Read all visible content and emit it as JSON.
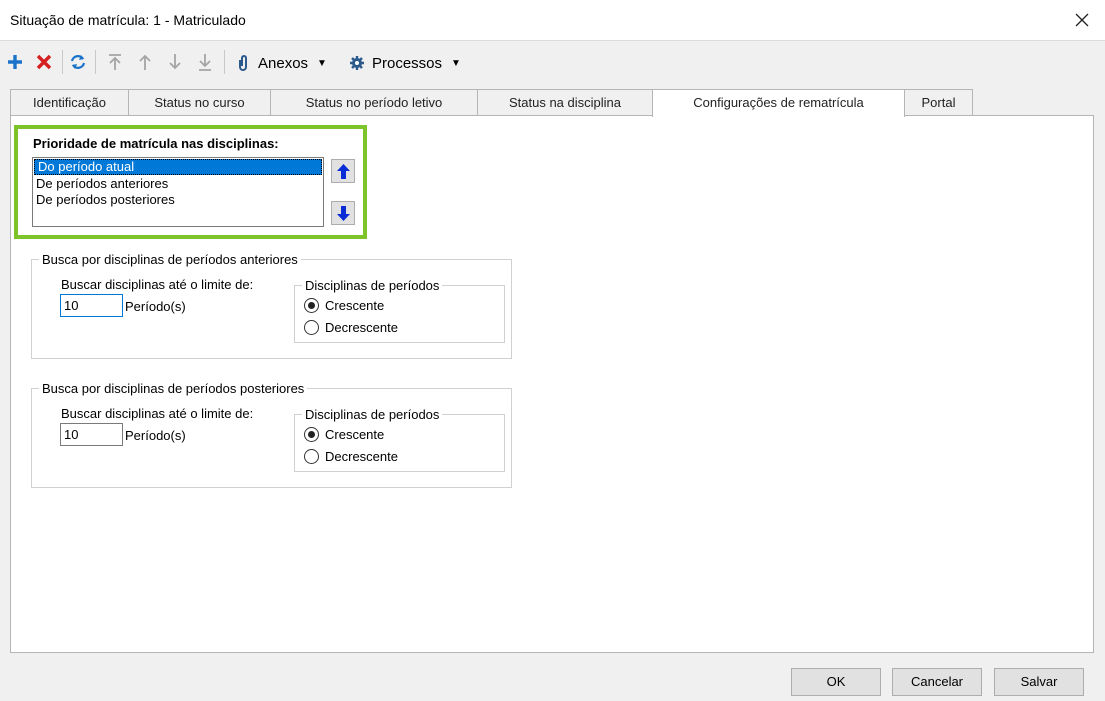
{
  "window": {
    "title": "Situação de matrícula: 1 - Matriculado"
  },
  "toolbar": {
    "anexos_label": "Anexos",
    "processos_label": "Processos"
  },
  "tabs": [
    {
      "label": "Identificação"
    },
    {
      "label": "Status no curso"
    },
    {
      "label": "Status no período letivo"
    },
    {
      "label": "Status na disciplina"
    },
    {
      "label": "Configurações de rematrícula"
    },
    {
      "label": "Portal"
    }
  ],
  "active_tab": "Configurações de rematrícula",
  "priority": {
    "label": "Prioridade de matrícula nas disciplinas:",
    "items": [
      {
        "label": "Do período atual",
        "selected": true
      },
      {
        "label": "De períodos anteriores",
        "selected": false
      },
      {
        "label": "De períodos posteriores",
        "selected": false
      }
    ]
  },
  "previous_group": {
    "legend": "Busca por disciplinas de períodos anteriores",
    "limit_label": "Buscar disciplinas até o limite de:",
    "limit_value": "10",
    "unit_label": "Período(s)",
    "order_legend": "Disciplinas de períodos",
    "options": [
      "Crescente",
      "Decrescente"
    ],
    "selected_option": "Crescente"
  },
  "later_group": {
    "legend": "Busca por disciplinas de períodos posteriores",
    "limit_label": "Buscar disciplinas até o limite de:",
    "limit_value": "10",
    "unit_label": "Período(s)",
    "order_legend": "Disciplinas de períodos",
    "options": [
      "Crescente",
      "Decrescente"
    ],
    "selected_option": "Crescente"
  },
  "footer": {
    "ok_label": "OK",
    "cancel_label": "Cancelar",
    "save_label": "Salvar"
  },
  "colors": {
    "highlight_border": "#7dc32a",
    "selection": "#0078d7",
    "add_icon": "#1a73c9",
    "delete_icon": "#d42020"
  }
}
